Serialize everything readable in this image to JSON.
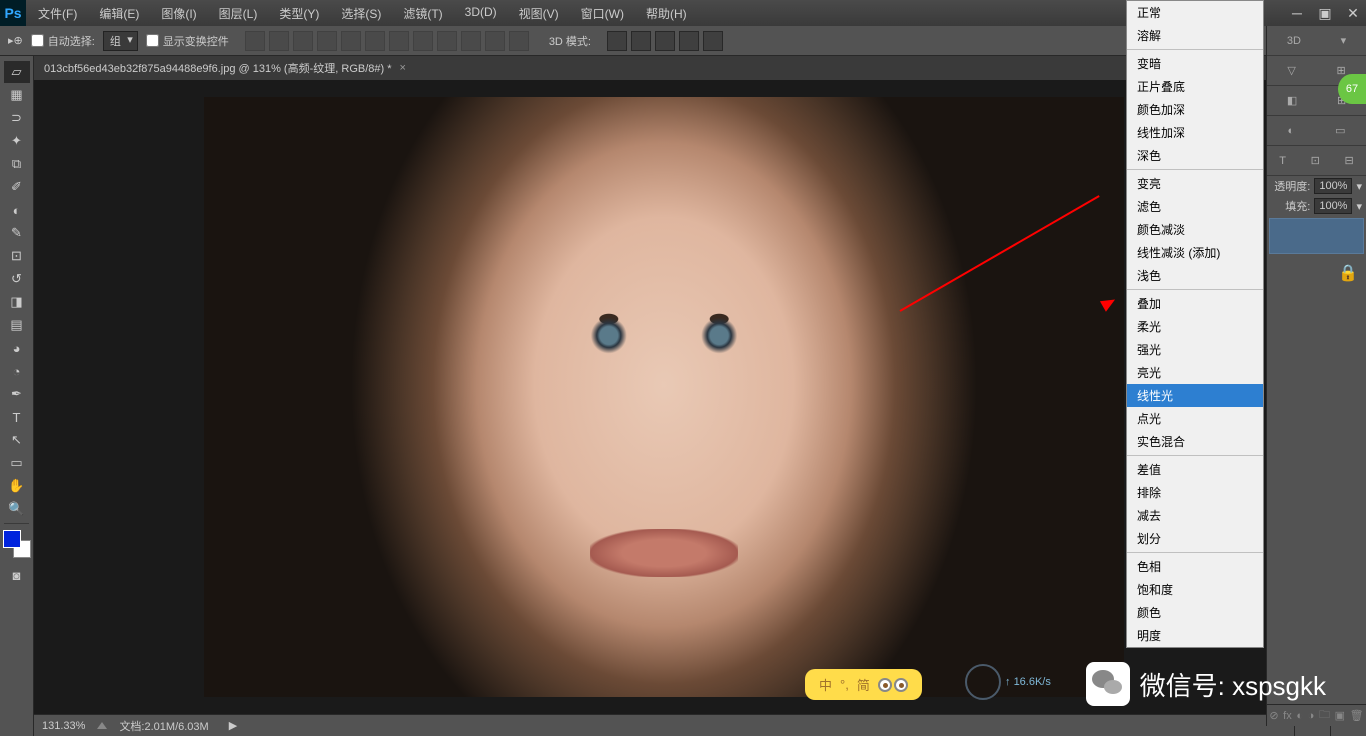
{
  "menubar": [
    "文件(F)",
    "编辑(E)",
    "图像(I)",
    "图层(L)",
    "类型(Y)",
    "选择(S)",
    "滤镜(T)",
    "3D(D)",
    "视图(V)",
    "窗口(W)",
    "帮助(H)"
  ],
  "optbar": {
    "auto_select": "自动选择:",
    "group": "组",
    "show_transform": "显示变换控件",
    "mode3d": "3D 模式:"
  },
  "doc_tab": "013cbf56ed43eb32f875a94488e9f6.jpg @ 131% (高频-纹理, RGB/8#) *",
  "status": {
    "zoom": "131.33%",
    "doc": "文档:2.01M/6.03M"
  },
  "blend_modes": {
    "g1": [
      "正常",
      "溶解"
    ],
    "g2": [
      "变暗",
      "正片叠底",
      "颜色加深",
      "线性加深",
      "深色"
    ],
    "g3": [
      "变亮",
      "滤色",
      "颜色减淡",
      "线性减淡 (添加)",
      "浅色"
    ],
    "g4": [
      "叠加",
      "柔光",
      "强光",
      "亮光",
      "线性光",
      "点光",
      "实色混合"
    ],
    "g5": [
      "差值",
      "排除",
      "减去",
      "划分"
    ],
    "g6": [
      "色相",
      "饱和度",
      "颜色",
      "明度"
    ]
  },
  "selected_blend": "线性光",
  "layers": {
    "opacity_label": "透明度:",
    "fill_label": "填充:",
    "opacity": "100%",
    "fill": "100%"
  },
  "ime": {
    "lang": "中",
    "punct": "°,",
    "simp": "简"
  },
  "net": "16.6K/s",
  "wechat": "微信号: xspsgkk",
  "green": "67",
  "right_panel_label": "3D"
}
